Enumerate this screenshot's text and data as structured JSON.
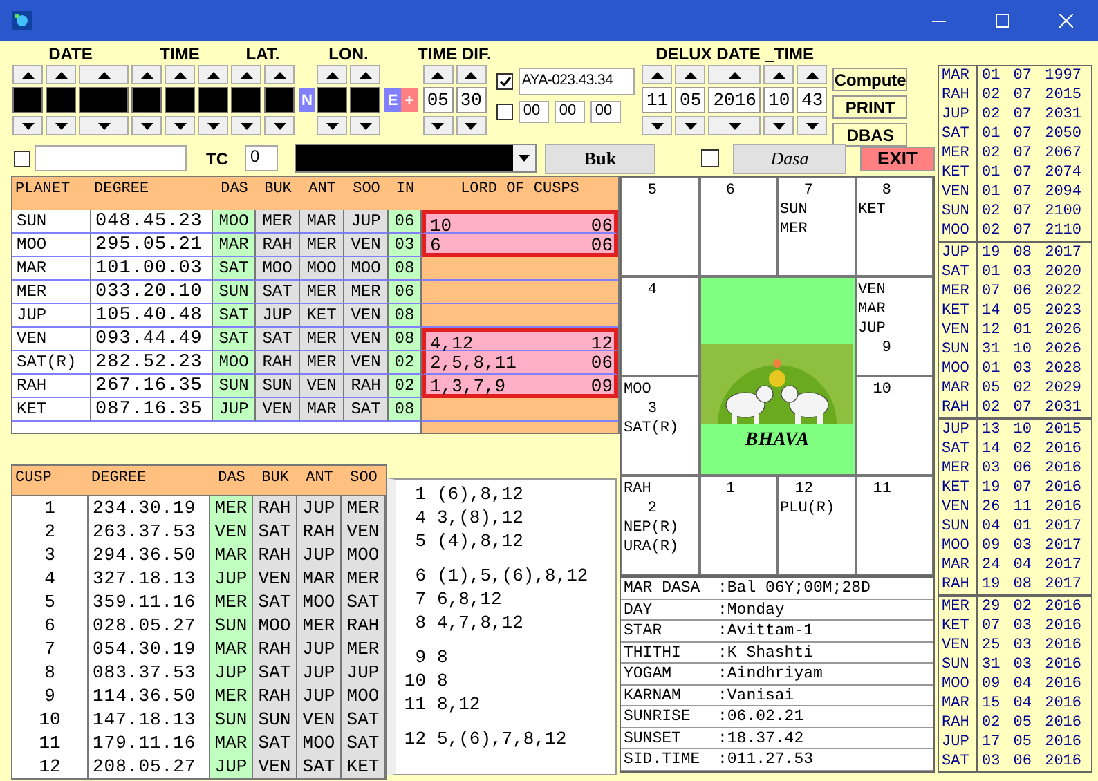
{
  "controls": [
    {
      "kind": "spinners",
      "label": "DATE",
      "columns": [
        {
          "masked": true
        },
        {
          "masked": true
        },
        {
          "masked": true
        }
      ]
    },
    {
      "kind": "spinners",
      "label": "TIME",
      "columns": [
        {
          "masked": true
        },
        {
          "masked": true
        },
        {
          "masked": true
        }
      ]
    },
    {
      "kind": "spinners",
      "label": "LAT.",
      "columns": [
        {
          "masked": true
        },
        {
          "masked": true
        }
      ]
    },
    {
      "kind": "badge",
      "text": "N",
      "color": "#8080ff"
    },
    {
      "kind": "spinners",
      "label": "LON.",
      "columns": [
        {
          "masked": true
        },
        {
          "masked": true
        }
      ]
    },
    {
      "kind": "badge",
      "text": "E",
      "color": "#8080ff"
    },
    {
      "kind": "badge",
      "text": "+",
      "color": "#ff8080"
    },
    {
      "kind": "spinners",
      "label": "TIME DIF.",
      "columns": [
        {
          "masked": false,
          "value": "05"
        },
        {
          "masked": false,
          "value": "30"
        }
      ]
    },
    {
      "kind": "ayanamsa",
      "checked": true,
      "value": "AYA-023.43.34",
      "offset_checked": false,
      "offset_fields": [
        "00",
        "00",
        "00"
      ]
    },
    {
      "kind": "spinners",
      "label": "DELUX DATE _TIME",
      "columns": [
        {
          "masked": false,
          "value": "11"
        },
        {
          "masked": false,
          "value": "05"
        },
        {
          "masked": false,
          "value": "2016"
        },
        {
          "masked": false,
          "value": "10"
        },
        {
          "masked": false,
          "value": "43"
        }
      ]
    },
    {
      "kind": "buttons",
      "buttons": [
        "Compute",
        "PRINT",
        "DBAS"
      ]
    }
  ],
  "toolbar": [
    {
      "kind": "checkbox",
      "checked": false
    },
    {
      "kind": "field"
    },
    {
      "kind": "label",
      "text": "TC"
    },
    {
      "kind": "field",
      "value": "0"
    },
    {
      "kind": "dropdown",
      "masked": true
    },
    {
      "kind": "bold_button",
      "label": "Buk"
    },
    {
      "kind": "checkbox",
      "checked": false
    },
    {
      "kind": "italic_button",
      "label": "Dasa"
    },
    {
      "kind": "alert_button",
      "label": "EXIT"
    }
  ],
  "planet_table": {
    "columns": [
      "PLANET",
      "DEGREE",
      "DAS",
      "BUK",
      "ANT",
      "SOO",
      "IN",
      "LORD OF CUSPS"
    ],
    "rows": [
      {
        "planet": "SUN",
        "degree": "048.45.23",
        "das": "MOO",
        "buk": "MER",
        "ant": "MAR",
        "soo": "JUP",
        "in": "06",
        "lords": "10",
        "lord_no": "06",
        "highlighted": true
      },
      {
        "planet": "MOO",
        "degree": "295.05.21",
        "das": "MAR",
        "buk": "RAH",
        "ant": "MER",
        "soo": "VEN",
        "in": "03",
        "lords": "6",
        "lord_no": "06",
        "highlighted": true
      },
      {
        "planet": "MAR",
        "degree": "101.00.03",
        "das": "SAT",
        "buk": "MOO",
        "ant": "MOO",
        "soo": "MOO",
        "in": "08",
        "highlighted": false
      },
      {
        "planet": "MER",
        "degree": "033.20.10",
        "das": "SUN",
        "buk": "SAT",
        "ant": "MER",
        "soo": "MER",
        "in": "06",
        "highlighted": false
      },
      {
        "planet": "JUP",
        "degree": "105.40.48",
        "das": "SAT",
        "buk": "JUP",
        "ant": "KET",
        "soo": "VEN",
        "in": "08",
        "highlighted": false
      },
      {
        "planet": "VEN",
        "degree": "093.44.49",
        "das": "SAT",
        "buk": "SAT",
        "ant": "MER",
        "soo": "VEN",
        "in": "08",
        "lords": "4,12",
        "lord_no": "12",
        "highlighted": true
      },
      {
        "planet": "SAT(R)",
        "degree": "282.52.23",
        "das": "MOO",
        "buk": "RAH",
        "ant": "MER",
        "soo": "VEN",
        "in": "02",
        "lords": "2,5,8,11",
        "lord_no": "06",
        "highlighted": true
      },
      {
        "planet": "RAH",
        "degree": "267.16.35",
        "das": "SUN",
        "buk": "SUN",
        "ant": "VEN",
        "soo": "RAH",
        "in": "02",
        "lords": "1,3,7,9",
        "lord_no": "09",
        "highlighted": true
      },
      {
        "planet": "KET",
        "degree": "087.16.35",
        "das": "JUP",
        "buk": "VEN",
        "ant": "MAR",
        "soo": "SAT",
        "in": "08",
        "highlighted": false
      }
    ]
  },
  "cusp_table": {
    "columns": [
      "CUSP",
      "DEGREE",
      "DAS",
      "BUK",
      "ANT",
      "SOO"
    ],
    "rows": [
      {
        "cusp": "1",
        "degree": "234.30.19",
        "das": "MER",
        "buk": "RAH",
        "ant": "JUP",
        "soo": "MER"
      },
      {
        "cusp": "2",
        "degree": "263.37.53",
        "das": "VEN",
        "buk": "SAT",
        "ant": "RAH",
        "soo": "VEN"
      },
      {
        "cusp": "3",
        "degree": "294.36.50",
        "das": "MAR",
        "buk": "RAH",
        "ant": "JUP",
        "soo": "MOO"
      },
      {
        "cusp": "4",
        "degree": "327.18.13",
        "das": "JUP",
        "buk": "VEN",
        "ant": "MAR",
        "soo": "MER"
      },
      {
        "cusp": "5",
        "degree": "359.11.16",
        "das": "MER",
        "buk": "SAT",
        "ant": "MOO",
        "soo": "SAT"
      },
      {
        "cusp": "6",
        "degree": "028.05.27",
        "das": "SUN",
        "buk": "MOO",
        "ant": "MER",
        "soo": "RAH"
      },
      {
        "cusp": "7",
        "degree": "054.30.19",
        "das": "MAR",
        "buk": "RAH",
        "ant": "JUP",
        "soo": "MER"
      },
      {
        "cusp": "8",
        "degree": "083.37.53",
        "das": "JUP",
        "buk": "SAT",
        "ant": "JUP",
        "soo": "JUP"
      },
      {
        "cusp": "9",
        "degree": "114.36.50",
        "das": "MER",
        "buk": "RAH",
        "ant": "JUP",
        "soo": "MOO"
      },
      {
        "cusp": "10",
        "degree": "147.18.13",
        "das": "SUN",
        "buk": "SUN",
        "ant": "VEN",
        "soo": "SAT"
      },
      {
        "cusp": "11",
        "degree": "179.11.16",
        "das": "MAR",
        "buk": "SAT",
        "ant": "MOO",
        "soo": "SAT"
      },
      {
        "cusp": "12",
        "degree": "208.05.27",
        "das": "JUP",
        "buk": "VEN",
        "ant": "SAT",
        "soo": "KET"
      }
    ]
  },
  "cusp_lords": [
    [
      {
        "cusp": "1",
        "lords": "(6),8,12"
      },
      {
        "cusp": "4",
        "lords": "3,(8),12"
      },
      {
        "cusp": "5",
        "lords": "(4),8,12"
      }
    ],
    [
      {
        "cusp": "6",
        "lords": "(1),5,(6),8,12"
      },
      {
        "cusp": "7",
        "lords": "6,8,12"
      },
      {
        "cusp": "8",
        "lords": "4,7,8,12"
      }
    ],
    [
      {
        "cusp": "9",
        "lords": "8"
      },
      {
        "cusp": "10",
        "lords": "8"
      },
      {
        "cusp": "11",
        "lords": "8,12"
      }
    ],
    [
      {
        "cusp": "12",
        "lords": "5,(6),7,8,12"
      }
    ]
  ],
  "chart": {
    "center_label": "BHAVA",
    "cells": [
      {
        "number": "5"
      },
      {
        "number": "6"
      },
      {
        "number": "7",
        "below": [
          "SUN",
          "MER"
        ]
      },
      {
        "number": "8",
        "below": [
          "KET"
        ]
      },
      {
        "number": "4"
      },
      {
        "above": [
          "VEN",
          "MAR",
          "JUP"
        ],
        "number": "9"
      },
      {
        "above": [
          "MOO"
        ],
        "number": "3",
        "below": [
          "SAT(R)"
        ]
      },
      {
        "number": "10"
      },
      {
        "above": [
          "RAH"
        ],
        "number": "2",
        "below": [
          "NEP(R)",
          "URA(R)"
        ]
      },
      {
        "number": "1"
      },
      {
        "number": "12",
        "below": [
          "PLU(R)"
        ]
      },
      {
        "number": "11"
      }
    ]
  },
  "info": [
    {
      "label": "MAR DASA",
      "value": ":Bal 06Y;00M;28D"
    },
    {
      "label": "DAY",
      "value": ":Monday"
    },
    {
      "label": "STAR",
      "value": ":Avittam-1"
    },
    {
      "label": "THITHI",
      "value": ":K Shashti"
    },
    {
      "label": "YOGAM",
      "value": ":Aindhriyam"
    },
    {
      "label": "KARNAM",
      "value": ":Vanisai"
    },
    {
      "label": "SUNRISE",
      "value": ":06.02.21"
    },
    {
      "label": "SUNSET",
      "value": ":18.37.42"
    },
    {
      "label": "SID.TIME",
      "value": ":011.27.53"
    }
  ],
  "dasa_periods": [
    [
      {
        "planet": "MAR",
        "date": "01 07 1997"
      },
      {
        "planet": "RAH",
        "date": "02 07 2015"
      },
      {
        "planet": "JUP",
        "date": "02 07 2031"
      },
      {
        "planet": "SAT",
        "date": "01 07 2050"
      },
      {
        "planet": "MER",
        "date": "02 07 2067"
      },
      {
        "planet": "KET",
        "date": "01 07 2074"
      },
      {
        "planet": "VEN",
        "date": "01 07 2094"
      },
      {
        "planet": "SUN",
        "date": "02 07 2100"
      },
      {
        "planet": "MOO",
        "date": "02 07 2110"
      }
    ],
    [
      {
        "planet": "JUP",
        "date": "19 08 2017"
      },
      {
        "planet": "SAT",
        "date": "01 03 2020"
      },
      {
        "planet": "MER",
        "date": "07 06 2022"
      },
      {
        "planet": "KET",
        "date": "14 05 2023"
      },
      {
        "planet": "VEN",
        "date": "12 01 2026"
      },
      {
        "planet": "SUN",
        "date": "31 10 2026"
      },
      {
        "planet": "MOO",
        "date": "01 03 2028"
      },
      {
        "planet": "MAR",
        "date": "05 02 2029"
      },
      {
        "planet": "RAH",
        "date": "02 07 2031"
      }
    ],
    [
      {
        "planet": "JUP",
        "date": "13 10 2015"
      },
      {
        "planet": "SAT",
        "date": "14 02 2016"
      },
      {
        "planet": "MER",
        "date": "03 06 2016"
      },
      {
        "planet": "KET",
        "date": "19 07 2016"
      },
      {
        "planet": "VEN",
        "date": "26 11 2016"
      },
      {
        "planet": "SUN",
        "date": "04 01 2017"
      },
      {
        "planet": "MOO",
        "date": "09 03 2017"
      },
      {
        "planet": "MAR",
        "date": "24 04 2017"
      },
      {
        "planet": "RAH",
        "date": "19 08 2017"
      }
    ],
    [
      {
        "planet": "MER",
        "date": "29 02 2016"
      },
      {
        "planet": "KET",
        "date": "07 03 2016"
      },
      {
        "planet": "VEN",
        "date": "25 03 2016"
      },
      {
        "planet": "SUN",
        "date": "31 03 2016"
      },
      {
        "planet": "MOO",
        "date": "09 04 2016"
      },
      {
        "planet": "MAR",
        "date": "15 04 2016"
      },
      {
        "planet": "RAH",
        "date": "02 05 2016"
      },
      {
        "planet": "JUP",
        "date": "17 05 2016"
      },
      {
        "planet": "SAT",
        "date": "03 06 2016"
      }
    ]
  ]
}
